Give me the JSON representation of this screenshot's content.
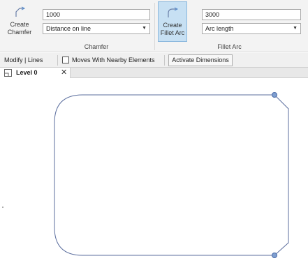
{
  "ribbon": {
    "chamfer": {
      "button_line1": "Create",
      "button_line2": "Chamfer",
      "distance_value": "1000",
      "mode_value": "Distance on line",
      "panel_label": "Chamfer"
    },
    "fillet": {
      "button_line1": "Create",
      "button_line2": "Fillet Arc",
      "length_value": "3000",
      "mode_value": "Arc length",
      "panel_label": "Fillet Arc"
    }
  },
  "options_bar": {
    "context_label": "Modify | Lines",
    "moves_with_nearby_label": "Moves With Nearby Elements",
    "moves_with_nearby_checked": false,
    "activate_dimensions_label": "Activate Dimensions"
  },
  "view_tabs": [
    {
      "label": "Level 0",
      "close": "✕"
    }
  ],
  "colors": {
    "shape_stroke": "#5b6e9e",
    "grip_fill": "#7f9fd0",
    "active_button": "#c7e0f3"
  },
  "icons": {
    "chamfer": "create-chamfer-icon",
    "fillet": "create-fillet-arc-icon",
    "tab": "floor-plan-view-icon",
    "close": "close-icon"
  }
}
